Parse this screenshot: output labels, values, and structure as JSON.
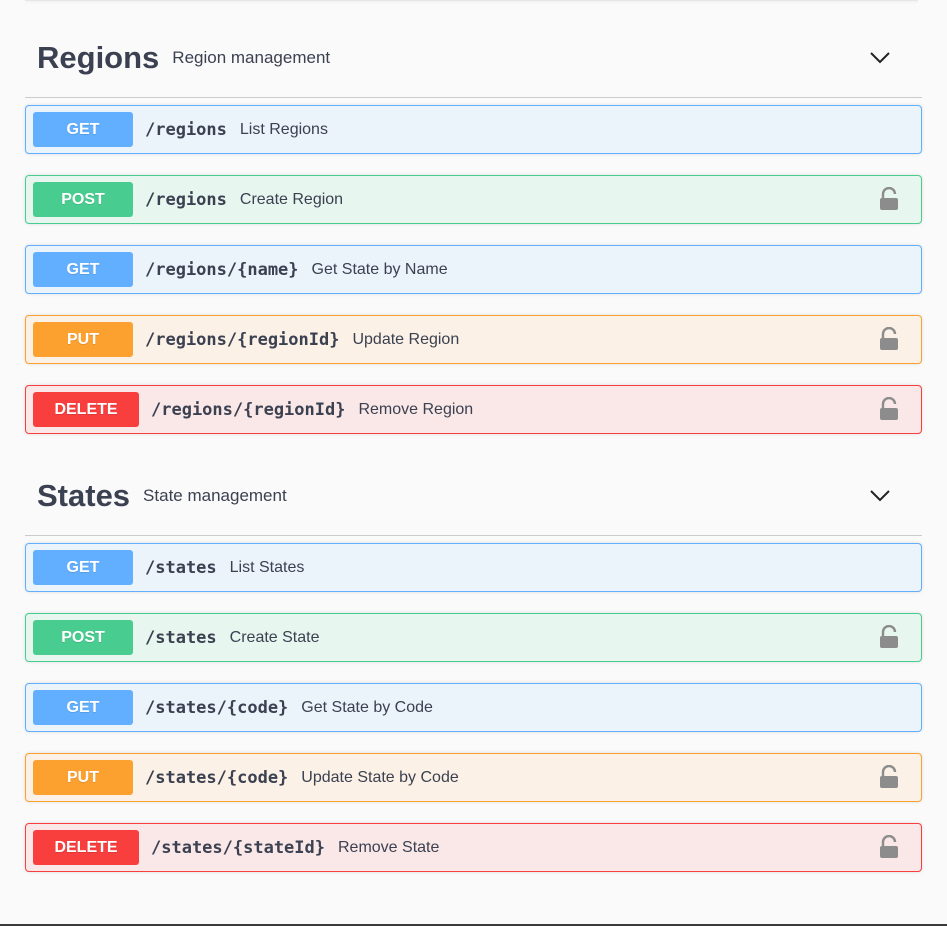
{
  "sections": [
    {
      "title": "Regions",
      "description": "Region management",
      "operations": [
        {
          "method": "GET",
          "path": "/regions",
          "summary": "List Regions",
          "locked": false
        },
        {
          "method": "POST",
          "path": "/regions",
          "summary": "Create Region",
          "locked": true
        },
        {
          "method": "GET",
          "path": "/regions/{name}",
          "summary": "Get State by Name",
          "locked": false
        },
        {
          "method": "PUT",
          "path": "/regions/{regionId}",
          "summary": "Update Region",
          "locked": true
        },
        {
          "method": "DELETE",
          "path": "/regions/{regionId}",
          "summary": "Remove Region",
          "locked": true
        }
      ]
    },
    {
      "title": "States",
      "description": "State management",
      "operations": [
        {
          "method": "GET",
          "path": "/states",
          "summary": "List States",
          "locked": false
        },
        {
          "method": "POST",
          "path": "/states",
          "summary": "Create State",
          "locked": true
        },
        {
          "method": "GET",
          "path": "/states/{code}",
          "summary": "Get State by Code",
          "locked": false
        },
        {
          "method": "PUT",
          "path": "/states/{code}",
          "summary": "Update State by Code",
          "locked": true
        },
        {
          "method": "DELETE",
          "path": "/states/{stateId}",
          "summary": "Remove State",
          "locked": true
        }
      ]
    }
  ],
  "icons": {
    "expand": "chevron-down-icon",
    "auth": "lock-icon"
  },
  "colors": {
    "get": "#61affe",
    "post": "#49cc90",
    "put": "#fca130",
    "delete": "#f93e3e"
  }
}
